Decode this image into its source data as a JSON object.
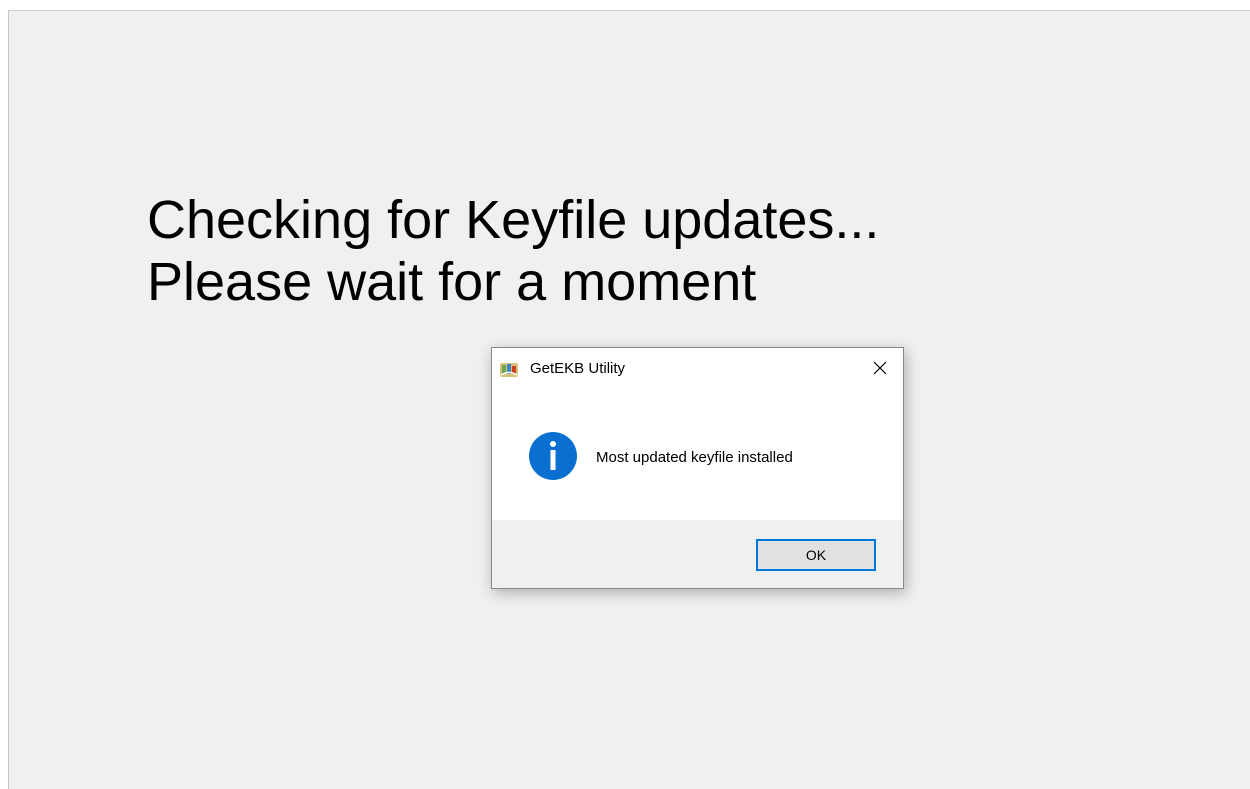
{
  "main": {
    "heading_line1": "Checking for Keyfile updates...",
    "heading_line2": "Please wait for a moment"
  },
  "dialog": {
    "title": "GetEKB Utility",
    "message": "Most updated keyfile installed",
    "ok_label": "OK",
    "icon": "info-icon",
    "accent_color": "#0078d7"
  }
}
